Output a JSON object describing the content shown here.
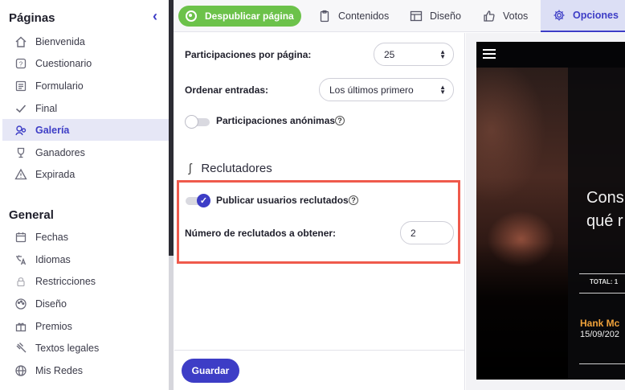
{
  "sidebar": {
    "pages_title": "Páginas",
    "pages_items": [
      {
        "label": "Bienvenida",
        "icon": "home-icon"
      },
      {
        "label": "Cuestionario",
        "icon": "question-icon"
      },
      {
        "label": "Formulario",
        "icon": "form-icon"
      },
      {
        "label": "Final",
        "icon": "check-icon"
      },
      {
        "label": "Galería",
        "icon": "gallery-icon",
        "active": true
      },
      {
        "label": "Ganadores",
        "icon": "trophy-icon"
      },
      {
        "label": "Expirada",
        "icon": "warning-icon"
      }
    ],
    "general_title": "General",
    "general_items": [
      {
        "label": "Fechas",
        "icon": "calendar-icon"
      },
      {
        "label": "Idiomas",
        "icon": "translate-icon"
      },
      {
        "label": "Restricciones",
        "icon": "lock-icon"
      },
      {
        "label": "Diseño",
        "icon": "palette-icon"
      },
      {
        "label": "Premios",
        "icon": "gift-icon"
      },
      {
        "label": "Textos legales",
        "icon": "gavel-icon"
      },
      {
        "label": "Mis Redes",
        "icon": "globe-icon"
      }
    ]
  },
  "topbar": {
    "unpublish_label": "Despublicar página",
    "tabs": [
      {
        "label": "Contenidos",
        "icon": "clipboard-icon"
      },
      {
        "label": "Diseño",
        "icon": "layout-icon"
      },
      {
        "label": "Votos",
        "icon": "thumbs-up-icon"
      },
      {
        "label": "Opciones",
        "icon": "gear-icon",
        "active": true
      }
    ]
  },
  "settings": {
    "per_page_label": "Participaciones por página:",
    "per_page_value": "25",
    "order_label": "Ordenar entradas:",
    "order_value": "Los últimos primero",
    "anonymous_label": "Participaciones anónimas",
    "anonymous_on": false,
    "recruiters_title": "Reclutadores",
    "publish_recruited_label": "Publicar usuarios reclutados",
    "publish_recruited_on": true,
    "recruit_count_label": "Número de reclutados a obtener:",
    "recruit_count_value": "2",
    "save_label": "Guardar",
    "help_glyph": "?"
  },
  "preview": {
    "headline_1": "Cons",
    "headline_2": "qué r",
    "total_label": "TOTAL: 1",
    "entry_name": "Hank Mc",
    "entry_date": "15/09/202"
  },
  "colors": {
    "accent": "#3d3dc6",
    "publish_green": "#6cc24a",
    "highlight_red": "#ef5a4c",
    "entry_name_orange": "#f0a23a"
  }
}
